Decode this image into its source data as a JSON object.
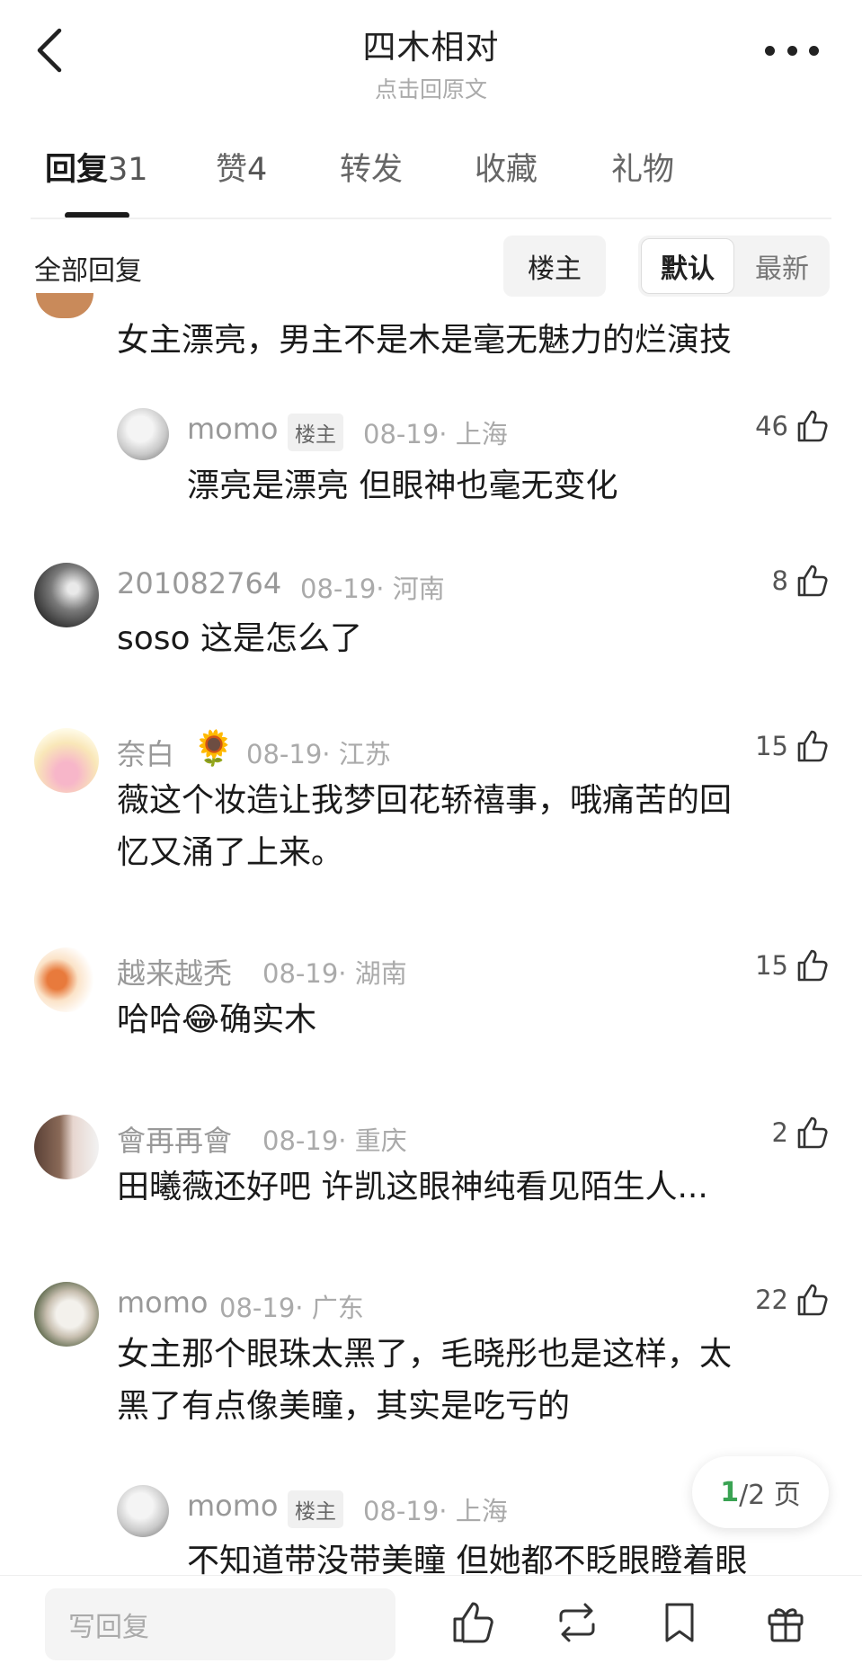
{
  "header": {
    "title": "四木相对",
    "subtitle": "点击回原文"
  },
  "tabs": [
    {
      "label": "回复",
      "count": "31"
    },
    {
      "label": "赞",
      "count": "4"
    },
    {
      "label": "转发",
      "count": ""
    },
    {
      "label": "收藏",
      "count": ""
    },
    {
      "label": "礼物",
      "count": ""
    }
  ],
  "filter": {
    "label": "全部回复",
    "owner_chip": "楼主",
    "sort_default": "默认",
    "sort_latest": "最新"
  },
  "comments": [
    {
      "text": "女主漂亮，男主不是木是毫无魅力的烂演技"
    },
    {
      "user": "momo",
      "tag": "楼主",
      "meta": "08-19· 上海",
      "likes": "46",
      "text": "漂亮是漂亮 但眼神也毫无变化"
    },
    {
      "user": "201082764",
      "meta": "08-19· 河南",
      "likes": "8",
      "text": "soso 这是怎么了"
    },
    {
      "user": "奈白",
      "badge": "🌻",
      "meta": "08-19· 江苏",
      "likes": "15",
      "text1": "薇这个妆造让我梦回花轿禧事，哦痛苦的回",
      "text2": "忆又涌了上来。"
    },
    {
      "user": "越来越秃",
      "meta": "08-19· 湖南",
      "likes": "15",
      "text_a": "哈哈",
      "emoji": "😂",
      "text_b": "确实木"
    },
    {
      "user": "會再再會",
      "meta": "08-19· 重庆",
      "likes": "2",
      "text": "田曦薇还好吧 许凯这眼神纯看见陌生人..."
    },
    {
      "user": "momo",
      "meta": "08-19· 广东",
      "likes": "22",
      "text1": "女主那个眼珠太黑了，毛晓彤也是这样，太",
      "text2": "黑了有点像美瞳，其实是吃亏的"
    },
    {
      "user": "momo",
      "tag": "楼主",
      "meta": "08-19· 上海",
      "text": "不知道带没带美瞳 但她都不眨眼瞪着眼"
    }
  ],
  "pager": {
    "current": "1",
    "total": "/2 页"
  },
  "bottombar": {
    "placeholder": "写回复"
  },
  "icons": [
    "back-icon",
    "more-icon",
    "thumbs-up-icon",
    "repost-icon",
    "bookmark-icon",
    "gift-icon"
  ]
}
